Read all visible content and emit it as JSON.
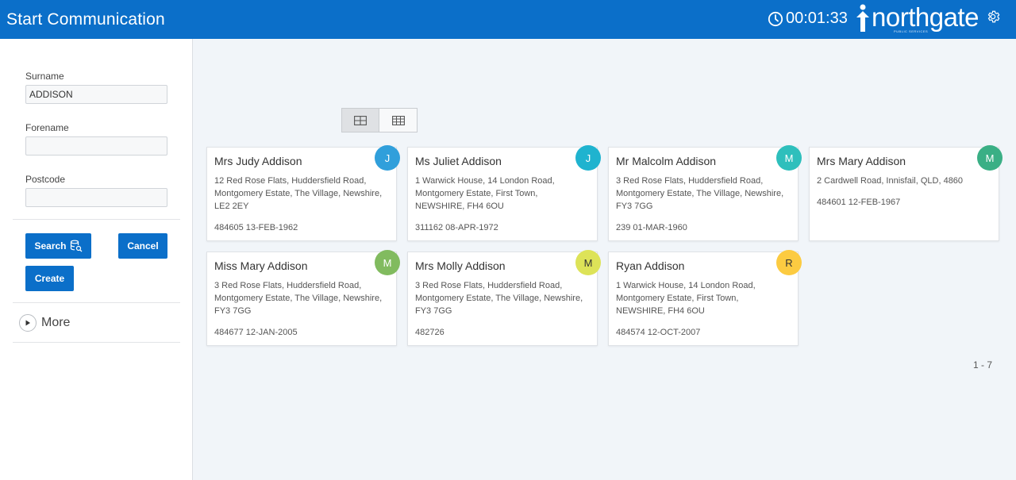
{
  "header": {
    "title": "Start Communication",
    "timer": "00:01:33",
    "logo_text": "northgate",
    "logo_sub": "PUBLIC SERVICES",
    "bg_color": "#0b6fc9"
  },
  "search": {
    "surname_label": "Surname",
    "surname_value": "ADDISON",
    "forename_label": "Forename",
    "forename_value": "",
    "postcode_label": "Postcode",
    "postcode_value": "",
    "search_label": "Search",
    "cancel_label": "Cancel",
    "create_label": "Create",
    "more_label": "More"
  },
  "view_toggle": {
    "active": "cards"
  },
  "cards": [
    {
      "name": "Mrs Judy Addison",
      "addr": "12 Red Rose Flats, Huddersfield Road, Montgomery Estate, The Village, Newshire, LE2 2EY",
      "foot": "484605 13-FEB-1962",
      "initial": "J",
      "color": "#309fdb"
    },
    {
      "name": "Ms Juliet Addison",
      "addr": "1 Warwick House, 14 London Road, Montgomery Estate, First Town, NEWSHIRE, FH4 6OU",
      "foot": "311162 08-APR-1972",
      "initial": "J",
      "color": "#1fb3cf"
    },
    {
      "name": "Mr Malcolm Addison",
      "addr": "3 Red Rose Flats, Huddersfield Road, Montgomery Estate, The Village, Newshire, FY3 7GG",
      "foot": "239 01-MAR-1960",
      "initial": "M",
      "color": "#2ebfbc"
    },
    {
      "name": "Mrs Mary Addison",
      "addr": "2 Cardwell Road, Innisfail, QLD, 4860",
      "foot": "484601 12-FEB-1967",
      "initial": "M",
      "color": "#3aaf85"
    },
    {
      "name": "Miss Mary Addison",
      "addr": "3 Red Rose Flats, Huddersfield Road, Montgomery Estate, The Village, Newshire, FY3 7GG",
      "foot": "484677 12-JAN-2005",
      "initial": "M",
      "color": "#81bb5f"
    },
    {
      "name": "Mrs Molly Addison",
      "addr": "3 Red Rose Flats, Huddersfield Road, Montgomery Estate, The Village, Newshire, FY3 7GG",
      "foot": "482726",
      "initial": "M",
      "color": "#dde358"
    },
    {
      "name": "Ryan Addison",
      "addr": "1 Warwick House, 14 London Road, Montgomery Estate, First Town, NEWSHIRE, FH4 6OU",
      "foot": "484574 12-OCT-2007",
      "initial": "R",
      "color": "#fccb41"
    }
  ],
  "pagination": "1 - 7"
}
